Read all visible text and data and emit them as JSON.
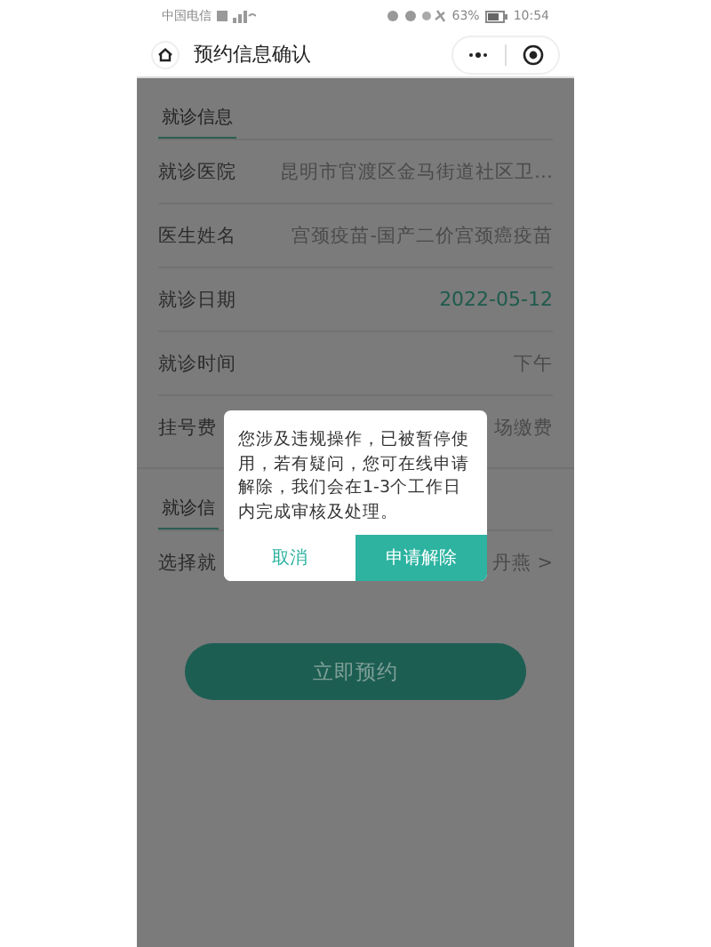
{
  "status_bar": {
    "carrier": "中国电信",
    "battery": "63%",
    "time": "10:54"
  },
  "nav": {
    "title": "预约信息确认"
  },
  "sections": [
    {
      "title": "就诊信息",
      "rows": [
        {
          "label": "就诊医院",
          "value": "昆明市官渡区金马街道社区卫…",
          "kind": "text"
        },
        {
          "label": "医生姓名",
          "value": "宫颈疫苗-国产二价宫颈癌疫苗",
          "kind": "text"
        },
        {
          "label": "就诊日期",
          "value": "2022-05-12",
          "kind": "highlight"
        },
        {
          "label": "就诊时间",
          "value": "下午",
          "kind": "text"
        },
        {
          "label": "挂号费",
          "value": "场缴费",
          "kind": "text"
        }
      ]
    },
    {
      "title": "就诊信",
      "rows": [
        {
          "label": "选择就",
          "value": "丹燕 >",
          "kind": "text"
        }
      ]
    }
  ],
  "submit": {
    "label": "立即预约"
  },
  "dialog": {
    "message": "您涉及违规操作，已被暂停使用，若有疑问，您可在线申请解除，我们会在1-3个工作日内完成审核及处理。",
    "buttons": [
      {
        "label": "取消",
        "kind": "cancel"
      },
      {
        "label": "申请解除",
        "kind": "confirm"
      }
    ]
  }
}
